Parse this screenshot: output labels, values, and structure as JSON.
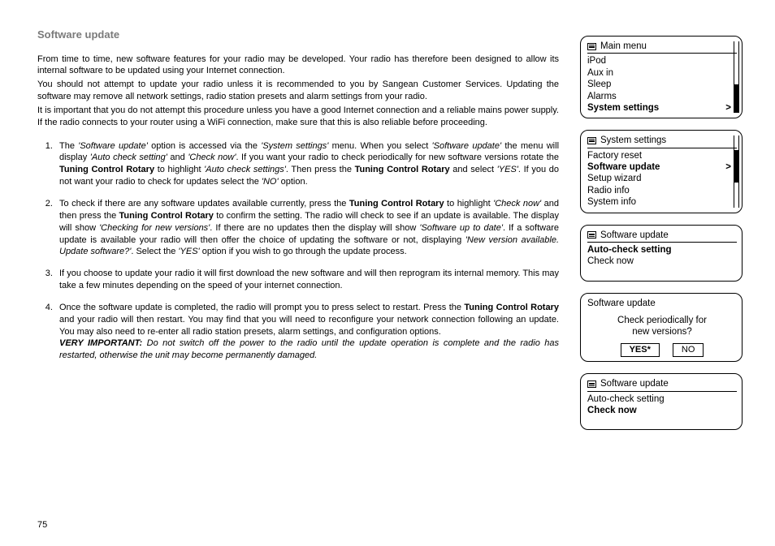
{
  "heading": "Software update",
  "para1": "From time to time, new software features for your radio may be developed. Your radio has therefore been designed to allow its internal software to be updated using your Internet connection.",
  "para2": "You should not attempt to update your radio unless it is recommended to you by Sangean Customer Services. Updating the software may remove all network settings, radio station presets and alarm settings from your radio.",
  "para3": "It is important that you do not attempt this procedure unless you have a good Internet connection and a reliable mains power supply. If the radio connects to your router using a WiFi connection, make sure that this is also reliable before proceeding.",
  "li1": {
    "a": "The ",
    "b": "'Software update'",
    "c": " option is accessed via the ",
    "d": "'System settings'",
    "e": " menu. When you select ",
    "f": "'Software update'",
    "g": " the menu will display ",
    "h": "'Auto check setting'",
    "i": " and ",
    "j": "'Check now'",
    "k": ". If you want your radio to check periodically for new software versions rotate the ",
    "l": "Tuning Control Rotary",
    "m": " to highlight ",
    "n": "'Auto check settings'",
    "o": ". Then press the ",
    "p": "Tuning Control Rotary",
    "q": " and select ",
    "r": "'YES'",
    "s": ". If you do not want your radio to check for updates select the ",
    "t": "'NO'",
    "u": " option."
  },
  "li2": {
    "a": "To check if there are any software updates available currently, press the ",
    "b": "Tuning Control Rotary",
    "c": " to highlight ",
    "d": "'Check now'",
    "e": " and then press the ",
    "f": "Tuning Control Rotary",
    "g": " to confirm the setting. The radio will check to see if an update is available. The display will show ",
    "h": "'Checking for new versions'",
    "i": ". If there are no updates then the display will show ",
    "j": "'Software up to date'",
    "k": ". If a software update is available your radio will then offer the choice of updating the software or not, displaying ",
    "l": "'New version available. Update software?'",
    "m": ". Select the ",
    "n": "'YES'",
    "o": " option if you wish to go through the update process."
  },
  "li3": "If you choose to update your radio it will first download the new software and will then reprogram its internal memory. This may take a few minutes depending on the speed of your internet connection.",
  "li4": {
    "a": "Once the software update is completed, the radio will prompt you to press select to restart. Press the ",
    "b": "Tuning Control Rotary",
    "c": " and your radio will then restart. You may find that you will need to reconfigure your network connection following an update. You may also need to re-enter all radio station presets, alarm settings, and configuration options.",
    "d": "VERY IMPORTANT:",
    "e": " Do not switch off the power to the radio until the update operation is complete and the radio has restarted, otherwise the unit may become permanently damaged."
  },
  "pagenum": "75",
  "screen1": {
    "title": "Main menu",
    "items": [
      "iPod",
      "Aux in",
      "Sleep",
      "Alarms"
    ],
    "sel": "System settings",
    "arrow": ">"
  },
  "screen2": {
    "title": "System settings",
    "top": "Factory reset",
    "sel": "Software update",
    "arrow": ">",
    "rest": [
      "Setup wizard",
      "Radio info",
      "System info"
    ]
  },
  "screen3": {
    "title": "Software update",
    "sel": "Auto-check setting",
    "rest": [
      "Check now"
    ]
  },
  "screen4": {
    "title": "Software update",
    "msg1": "Check periodically for",
    "msg2": "new versions?",
    "yes": "YES",
    "star": "*",
    "no": "NO"
  },
  "screen5": {
    "title": "Software update",
    "top": "Auto-check setting",
    "sel": "Check now"
  }
}
